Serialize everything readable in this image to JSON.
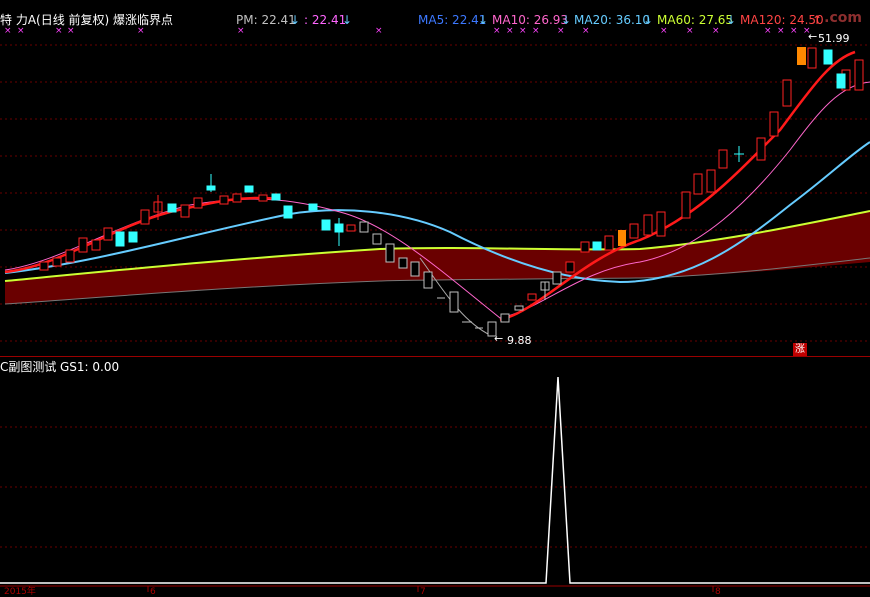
{
  "header": {
    "stock_title": "特 力A(日线 前复权) 爆涨临界点",
    "pm_label": "PM: 22.41",
    "pm_arrow": "↓",
    "pm_value2": ": 22.41",
    "pm_arrow2": "↓",
    "ma5": "MA5: 22.41",
    "ma10": "MA10: 26.93",
    "ma20": "MA20: 36.10",
    "ma60": "MA60: 27.65",
    "ma120": "MA120: 24.50",
    "arrow": "↓",
    "arrow_up": "↑",
    "watermark": ".com"
  },
  "colors": {
    "ma5": "#1e6bff",
    "ma10": "#ff66cc",
    "ma20": "#66ccff",
    "ma60": "#ccff33",
    "ma120": "#ff3333",
    "up": "#ff2222",
    "down": "#33ffff",
    "band": "#6a0000"
  },
  "annotations": {
    "high_label": "51.99",
    "low_label": "9.88",
    "zhang_badge": "涨"
  },
  "sub_panel": {
    "title": "C副图测试",
    "gs1": "GS1: 0.00"
  },
  "x_axis": {
    "labels": [
      "2015年",
      "6",
      "7",
      "8"
    ]
  }
}
